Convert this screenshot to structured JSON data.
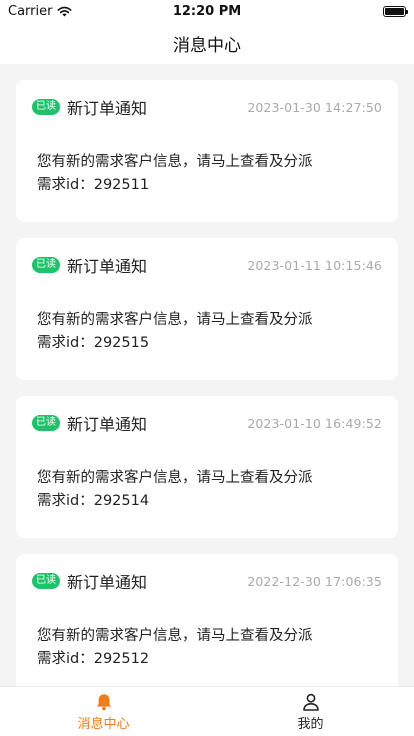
{
  "status_bar": {
    "carrier": "Carrier",
    "time": "12:20 PM",
    "icons": [
      "wifi-icon",
      "battery-icon"
    ]
  },
  "nav": {
    "title": "消息中心"
  },
  "messages": [
    {
      "badge": "已读",
      "title": "新订单通知",
      "time": "2023-01-30 14:27:50",
      "line1": "您有新的需求客户信息，请马上查看及分派",
      "line2": "需求id：292511"
    },
    {
      "badge": "已读",
      "title": "新订单通知",
      "time": "2023-01-11 10:15:46",
      "line1": "您有新的需求客户信息，请马上查看及分派",
      "line2": "需求id：292515"
    },
    {
      "badge": "已读",
      "title": "新订单通知",
      "time": "2023-01-10 16:49:52",
      "line1": "您有新的需求客户信息，请马上查看及分派",
      "line2": "需求id：292514"
    },
    {
      "badge": "已读",
      "title": "新订单通知",
      "time": "2022-12-30 17:06:35",
      "line1": "您有新的需求客户信息，请马上查看及分派",
      "line2": "需求id：292512"
    }
  ],
  "tabs": [
    {
      "label": "消息中心",
      "icon": "bell-icon",
      "active": true
    },
    {
      "label": "我的",
      "icon": "user-icon",
      "active": false
    }
  ],
  "colors": {
    "accent": "#f07c1a",
    "badge": "#1ec26a",
    "time_text": "#aaaaaa",
    "background": "#f4f4f4"
  }
}
